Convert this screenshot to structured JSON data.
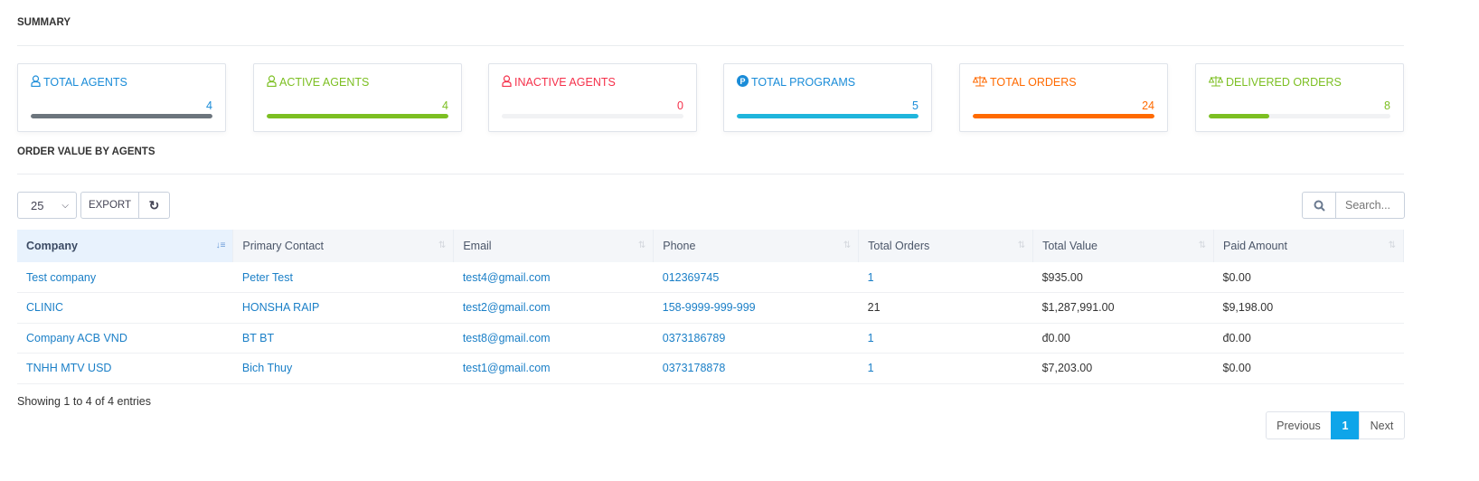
{
  "summary_title": "SUMMARY",
  "cards": [
    {
      "label": "TOTAL AGENTS",
      "value": "4",
      "icon": "user-icon",
      "color": "#1a8cd8",
      "bar": "#6c757d",
      "fill": 1
    },
    {
      "label": "ACTIVE AGENTS",
      "value": "4",
      "icon": "user-icon",
      "color": "#7cbf22",
      "bar": "#7cbf22",
      "fill": 1
    },
    {
      "label": "INACTIVE AGENTS",
      "value": "0",
      "icon": "user-icon",
      "color": "#f5304a",
      "bar": "#f5304a",
      "fill": 0
    },
    {
      "label": "TOTAL PROGRAMS",
      "value": "5",
      "icon": "p-circle-icon",
      "color": "#1a8cd8",
      "bar": "#1fb5dc",
      "fill": 1
    },
    {
      "label": "TOTAL ORDERS",
      "value": "24",
      "icon": "scale-icon",
      "color": "#ff6a00",
      "bar": "#ff6a00",
      "fill": 1
    },
    {
      "label": "DELIVERED ORDERS",
      "value": "8",
      "icon": "scale-icon",
      "color": "#7cbf22",
      "bar": "#7cbf22",
      "fill": 0.333
    }
  ],
  "order_title": "ORDER VALUE BY AGENTS",
  "toolbar": {
    "page_size": "25",
    "export": "EXPORT",
    "search_placeholder": "Search..."
  },
  "columns": [
    "Company",
    "Primary Contact",
    "Email",
    "Phone",
    "Total Orders",
    "Total Value",
    "Paid Amount"
  ],
  "rows": [
    [
      "Test company",
      "Peter Test",
      "test4@gmail.com",
      "012369745",
      "1",
      "$935.00",
      "$0.00"
    ],
    [
      "CLINIC",
      "HONSHA RAIP",
      "test2@gmail.com",
      "158-9999-999-999",
      "21",
      "$1,287,991.00",
      "$9,198.00"
    ],
    [
      "Company ACB VND",
      "BT BT",
      "test8@gmail.com",
      "0373186789",
      "1",
      "đ0.00",
      "đ0.00"
    ],
    [
      "TNHH MTV USD",
      "Bich Thuy",
      "test1@gmail.com",
      "0373178878",
      "1",
      "$7,203.00",
      "$0.00"
    ]
  ],
  "info": "Showing 1 to 4 of 4 entries",
  "pagination": {
    "prev": "Previous",
    "current": "1",
    "next": "Next"
  }
}
